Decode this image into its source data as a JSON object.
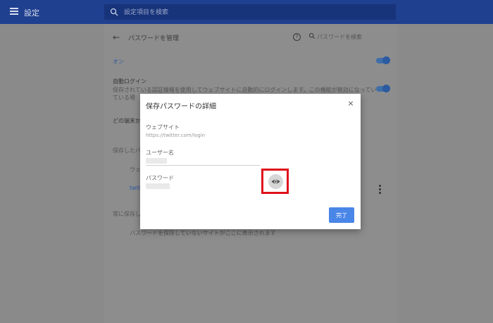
{
  "app": {
    "title": "設定"
  },
  "search": {
    "placeholder": "設定項目を検索"
  },
  "page": {
    "title": "パスワードを管理",
    "search_label": "パスワードを検索",
    "on_label": "オン",
    "auto_signin_title": "自動ログイン",
    "auto_signin_desc_1": "保存されている認証情報を使用してウェブサイトに自動的にログインします。この機能が無効になってい",
    "auto_signin_desc_2": "ている場",
    "saved_prompt_partial": "どの端末か",
    "saved_passwords_header": "保存したパ",
    "col_website_partial": "ウェ",
    "row_site_partial": "twitt",
    "never_saved_header": "常に保存し",
    "never_saved_empty": "パスワードを保存していないサイトがここに表示されます"
  },
  "dialog": {
    "title": "保存パスワードの詳細",
    "close_icon": "×",
    "website_label": "ウェブサイト",
    "website_value": "https://twitter.com/login",
    "username_label": "ユーザー名",
    "password_label": "パスワード",
    "done_label": "完了"
  },
  "colors": {
    "appbar": "#1f3f8f",
    "accent": "#4a86e8",
    "highlight": "#e0111c"
  },
  "icons": [
    "menu-icon",
    "search-icon",
    "back-arrow-icon",
    "help-icon",
    "close-icon",
    "eye-icon",
    "more-vert-icon"
  ]
}
